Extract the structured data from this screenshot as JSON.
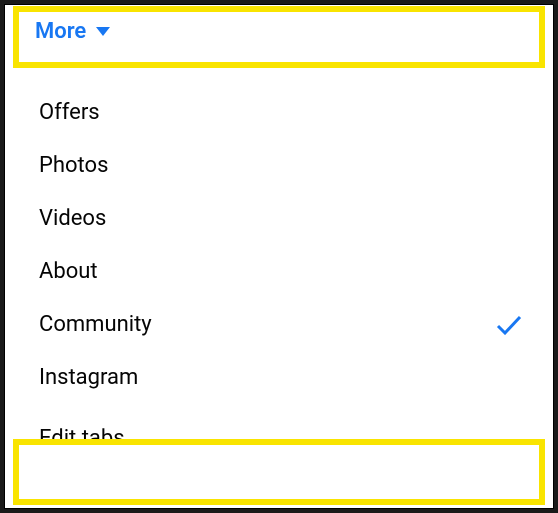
{
  "header": {
    "more_label": "More"
  },
  "menu": {
    "items": [
      {
        "label": "Offers",
        "checked": false
      },
      {
        "label": "Photos",
        "checked": false
      },
      {
        "label": "Videos",
        "checked": false
      },
      {
        "label": "About",
        "checked": false
      },
      {
        "label": "Community",
        "checked": true
      },
      {
        "label": "Instagram",
        "checked": false
      },
      {
        "label": "Edit tabs",
        "checked": false
      }
    ]
  }
}
